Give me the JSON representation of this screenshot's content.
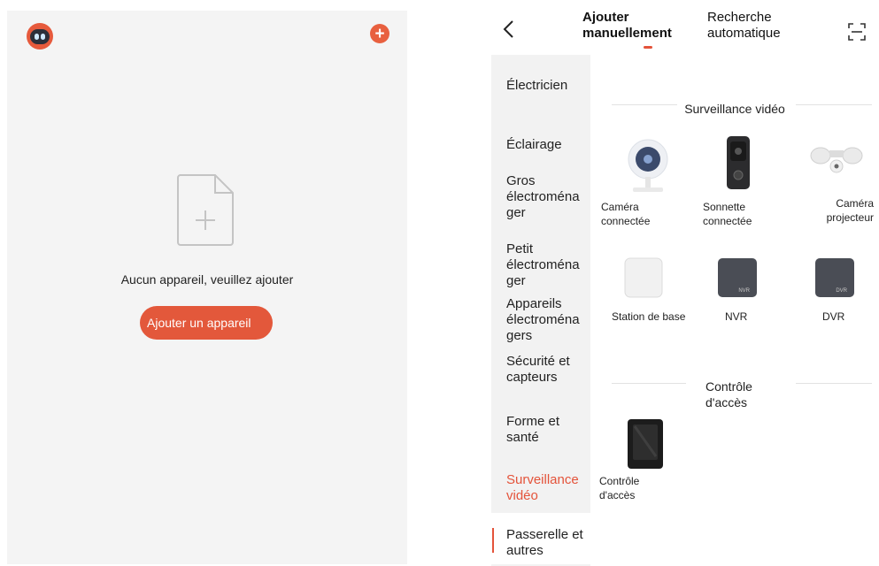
{
  "home": {
    "empty_message": "Aucun appareil, veuillez ajouter",
    "add_button": "Ajouter un appareil"
  },
  "header": {
    "tab_manual_line1": "Ajouter",
    "tab_manual_line2": "manuellement",
    "tab_auto_line1": "Recherche",
    "tab_auto_line2": "automatique"
  },
  "sidebar": {
    "items": [
      {
        "lines": [
          "Électricien"
        ]
      },
      {
        "lines": [
          "Éclairage"
        ]
      },
      {
        "lines": [
          "Gros",
          "électroména",
          "ger"
        ]
      },
      {
        "lines": [
          "Petit",
          "électroména",
          "ger"
        ]
      },
      {
        "lines": [
          "Appareils",
          "électroména",
          "gers"
        ]
      },
      {
        "lines": [
          "Sécurité et",
          "capteurs"
        ]
      },
      {
        "lines": [
          "Forme et",
          "santé"
        ]
      },
      {
        "lines": [
          "Surveillance",
          "vidéo"
        ]
      },
      {
        "lines": [
          "Passerelle et",
          "autres"
        ]
      }
    ],
    "active_index": 7
  },
  "sections": {
    "video": {
      "title": "Surveillance vidéo",
      "devices": [
        {
          "lines": [
            "Caméra",
            "connectée"
          ]
        },
        {
          "lines": [
            "Sonnette",
            "connectée"
          ]
        },
        {
          "lines": [
            "Caméra",
            "projecteur"
          ]
        },
        {
          "lines": [
            "Station de base"
          ]
        },
        {
          "lines": [
            "NVR"
          ],
          "badge": "NVR"
        },
        {
          "lines": [
            "DVR"
          ],
          "badge": "DVR"
        }
      ]
    },
    "access": {
      "title_line1": "Contrôle",
      "title_line2": "d'accès",
      "devices": [
        {
          "lines": [
            "Contrôle",
            "d'accès"
          ]
        }
      ]
    }
  },
  "colors": {
    "accent": "#e4533a",
    "panel_bg": "#f4f4f4",
    "sidebar_bg": "#f2f2f2"
  }
}
